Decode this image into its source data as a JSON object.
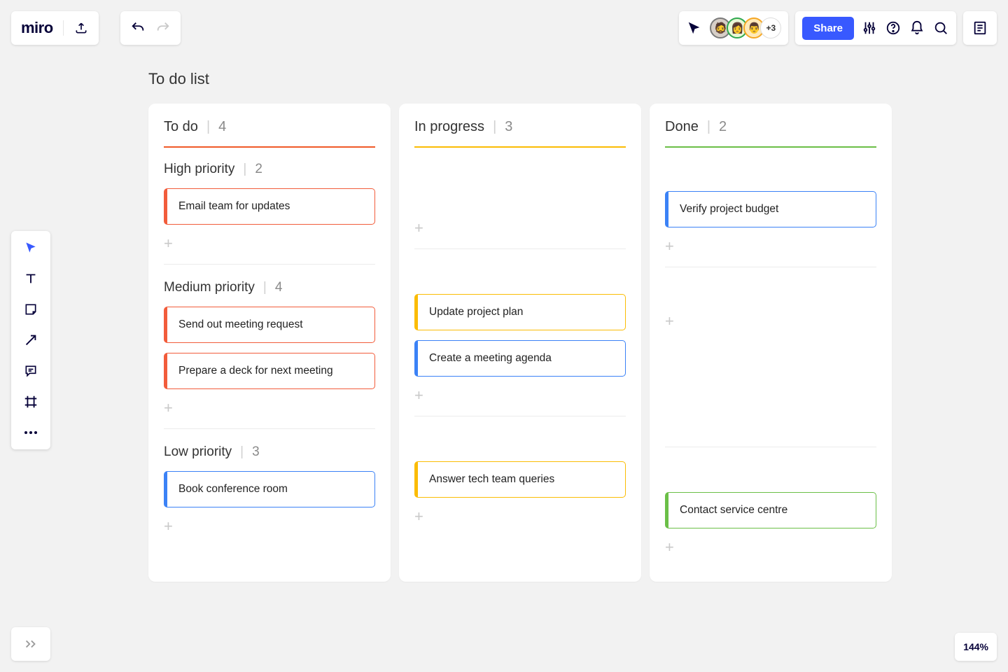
{
  "app": {
    "logo": "miro",
    "overflow_avatars": "+3",
    "share": "Share",
    "zoom": "144%"
  },
  "board_title": "To do list",
  "columns": [
    {
      "title": "To do",
      "count": "4",
      "rule": "rule-todo"
    },
    {
      "title": "In progress",
      "count": "3",
      "rule": "rule-prog"
    },
    {
      "title": "Done",
      "count": "2",
      "rule": "rule-done"
    }
  ],
  "sections": [
    {
      "title": "High priority",
      "count": "2"
    },
    {
      "title": "Medium priority",
      "count": "4"
    },
    {
      "title": "Low priority",
      "count": "3"
    }
  ],
  "cards": {
    "todo_high_0": "Email team for updates",
    "todo_med_0": "Send out meeting request",
    "todo_med_1": "Prepare a deck for next meeting",
    "todo_low_0": "Book conference room",
    "prog_med_0": "Update project plan",
    "prog_med_1": "Create a meeting agenda",
    "prog_low_0": "Answer tech team queries",
    "done_high_0": "Verify project budget",
    "done_low_0": "Contact service centre"
  },
  "plus": "+"
}
